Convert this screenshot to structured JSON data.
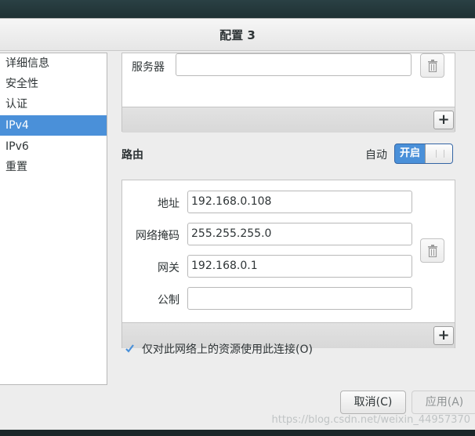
{
  "window": {
    "title": "配置 3"
  },
  "sidebar": {
    "items": [
      {
        "label": "详细信息",
        "selected": false
      },
      {
        "label": "安全性",
        "selected": false
      },
      {
        "label": "认证",
        "selected": false
      },
      {
        "label": "IPv4",
        "selected": true
      },
      {
        "label": "IPv6",
        "selected": false
      },
      {
        "label": "重置",
        "selected": false
      }
    ]
  },
  "server": {
    "label": "服务器",
    "value": ""
  },
  "routes": {
    "title": "路由",
    "auto_label": "自动",
    "toggle_state": "开启",
    "address_label": "地址",
    "address_value": "192.168.0.108",
    "netmask_label": "网络掩码",
    "netmask_value": "255.255.255.0",
    "gateway_label": "网关",
    "gateway_value": "192.168.0.1",
    "metric_label": "公制",
    "metric_value": ""
  },
  "options": {
    "local_only_label": "仅对此网络上的资源使用此连接(O)",
    "local_only_checked": true
  },
  "buttons": {
    "cancel": "取消(C)",
    "apply": "应用(A)",
    "add": "+"
  },
  "watermark": "https://blog.csdn.net/weixin_44957370",
  "colors": {
    "selection": "#4a90d9",
    "window_bg": "#ededed"
  }
}
